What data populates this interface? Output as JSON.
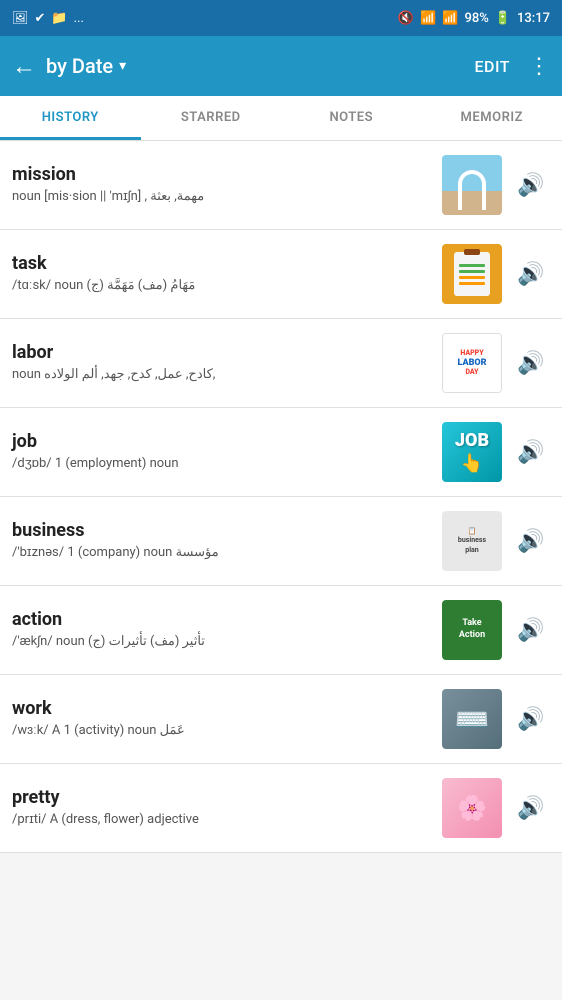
{
  "statusBar": {
    "leftIcons": [
      "🖼",
      "✔",
      "🔋"
    ],
    "ellipsis": "...",
    "muteIcon": "🔇",
    "wifiIcon": "WiFi",
    "signalIcon": "📶",
    "battery": "98%",
    "time": "13:17"
  },
  "appBar": {
    "backLabel": "←",
    "title": "by Date",
    "chevron": "▾",
    "editLabel": "EDIT",
    "moreLabel": "⋮"
  },
  "tabs": [
    {
      "id": "history",
      "label": "HISTORY",
      "active": true
    },
    {
      "id": "starred",
      "label": "STARRED",
      "active": false
    },
    {
      "id": "notes",
      "label": "NOTES",
      "active": false
    },
    {
      "id": "memoriz",
      "label": "MEMORIZ",
      "active": false
    }
  ],
  "words": [
    {
      "id": "mission",
      "title": "mission",
      "definition": "noun [mis·sion || 'mɪʃn] , مهمة, بعثة",
      "imageType": "mission",
      "soundLabel": "🔊"
    },
    {
      "id": "task",
      "title": "task",
      "definition": "/tɑːsk/ noun  مَهَامُ (مف) مَهَمَّة (ج)",
      "imageType": "task",
      "soundLabel": "🔊"
    },
    {
      "id": "labor",
      "title": "labor",
      "definition": "noun  كادح, عمل, كدح, جهد, ألم الولاده,",
      "imageType": "labor",
      "soundLabel": "🔊"
    },
    {
      "id": "job",
      "title": "job",
      "definition": "/dʒɒb/ 1 (employment) noun",
      "imageType": "job",
      "soundLabel": "🔊"
    },
    {
      "id": "business",
      "title": "business",
      "definition": "/'bɪznəs/ 1 (company) noun  مؤسسة",
      "imageType": "business",
      "soundLabel": "🔊"
    },
    {
      "id": "action",
      "title": "action",
      "definition": "/'ækʃn/ noun  تأثير (مف) تأثيرات (ج)",
      "imageType": "action",
      "soundLabel": "🔊"
    },
    {
      "id": "work",
      "title": "work",
      "definition": "/wɜːk/ A 1 (activity) noun  عَمَل",
      "imageType": "work",
      "soundLabel": "🔊"
    },
    {
      "id": "pretty",
      "title": "pretty",
      "definition": "/prɪti/ A (dress, flower) adjective",
      "imageType": "pretty",
      "soundLabel": "🔊"
    }
  ]
}
